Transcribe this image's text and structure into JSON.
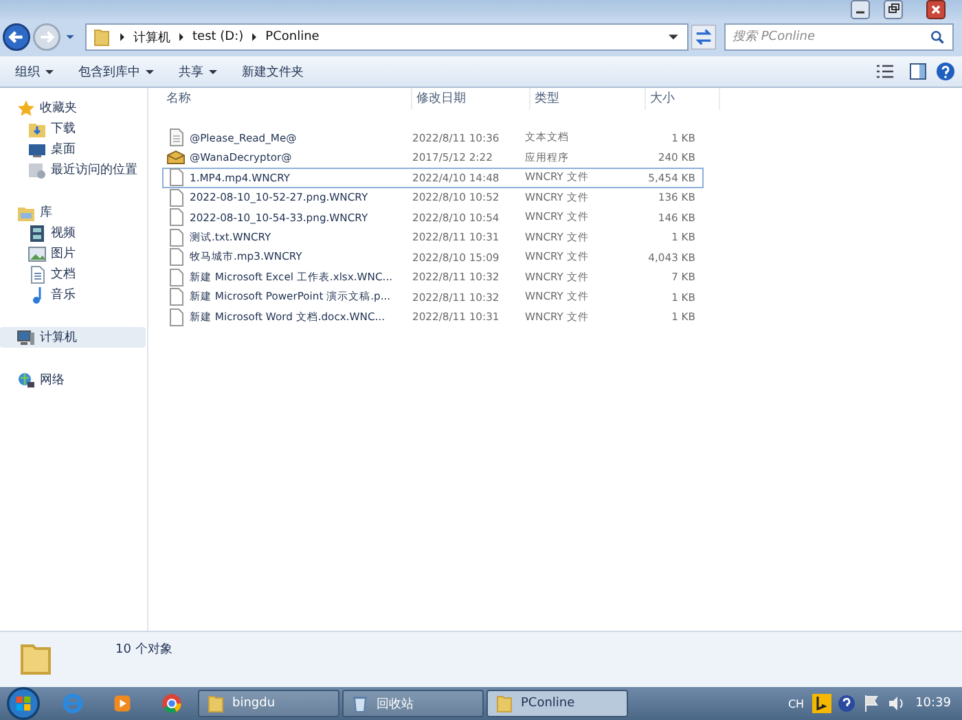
{
  "address_bar": {
    "path": [
      {
        "label": "计算机"
      },
      {
        "label": "test (D:)"
      },
      {
        "label": "PConline"
      }
    ]
  },
  "search": {
    "placeholder": "搜索 PConline"
  },
  "toolbar": {
    "buttons": [
      {
        "label": "组织",
        "dropdown": true
      },
      {
        "label": "包含到库中",
        "dropdown": true
      },
      {
        "label": "共享",
        "dropdown": true
      },
      {
        "label": "新建文件夹",
        "dropdown": false
      }
    ]
  },
  "sidebar": {
    "groups": [
      {
        "label": "收藏夹",
        "selected": false,
        "children": [
          {
            "label": "下载",
            "selected": false
          },
          {
            "label": "桌面",
            "selected": false
          },
          {
            "label": "最近访问的位置",
            "selected": false
          }
        ]
      },
      {
        "label": "库",
        "selected": false,
        "children": [
          {
            "label": "视频",
            "selected": false
          },
          {
            "label": "图片",
            "selected": false
          },
          {
            "label": "文档",
            "selected": false
          },
          {
            "label": "音乐",
            "selected": false
          }
        ]
      },
      {
        "label": "计算机",
        "selected": true
      },
      {
        "label": "网络",
        "selected": false
      }
    ]
  },
  "table": {
    "columns": [
      "名称",
      "修改日期",
      "类型",
      "大小"
    ],
    "rows": [
      {
        "name": "@Please_Read_Me@",
        "kind": "text",
        "modified": "2022/8/11 10:36",
        "type": "文本文档",
        "size": "1 KB",
        "focused": false
      },
      {
        "name": "@WanaDecryptor@",
        "kind": "app",
        "modified": "2017/5/12 2:22",
        "type": "应用程序",
        "size": "240 KB",
        "focused": false
      },
      {
        "name": "1.MP4.mp4.WNCRY",
        "kind": "file",
        "modified": "2022/4/10 14:48",
        "type": "WNCRY 文件",
        "size": "5,454 KB",
        "focused": true
      },
      {
        "name": "2022-08-10_10-52-27.png.WNCRY",
        "kind": "file",
        "modified": "2022/8/10 10:52",
        "type": "WNCRY 文件",
        "size": "136 KB",
        "focused": false
      },
      {
        "name": "2022-08-10_10-54-33.png.WNCRY",
        "kind": "file",
        "modified": "2022/8/10 10:54",
        "type": "WNCRY 文件",
        "size": "146 KB",
        "focused": false
      },
      {
        "name": "测试.txt.WNCRY",
        "kind": "file",
        "modified": "2022/8/11 10:31",
        "type": "WNCRY 文件",
        "size": "1 KB",
        "focused": false
      },
      {
        "name": "牧马城市.mp3.WNCRY",
        "kind": "file",
        "modified": "2022/8/10 15:09",
        "type": "WNCRY 文件",
        "size": "4,043 KB",
        "focused": false
      },
      {
        "name": "新建 Microsoft Excel 工作表.xlsx.WNC...",
        "kind": "file",
        "modified": "2022/8/11 10:32",
        "type": "WNCRY 文件",
        "size": "7 KB",
        "focused": false
      },
      {
        "name": "新建 Microsoft PowerPoint 演示文稿.p...",
        "kind": "file",
        "modified": "2022/8/11 10:32",
        "type": "WNCRY 文件",
        "size": "1 KB",
        "focused": false
      },
      {
        "name": "新建 Microsoft Word 文档.docx.WNC...",
        "kind": "file",
        "modified": "2022/8/11 10:31",
        "type": "WNCRY 文件",
        "size": "1 KB",
        "focused": false
      }
    ]
  },
  "status_bar": {
    "count": "10 个对象"
  },
  "taskbar": {
    "windows": [
      {
        "label": "bingdu",
        "selected": false
      },
      {
        "label": "回收站",
        "selected": false
      },
      {
        "label": "PConline",
        "selected": true
      }
    ],
    "tray": {
      "language": "CH",
      "time": "10:39"
    }
  }
}
